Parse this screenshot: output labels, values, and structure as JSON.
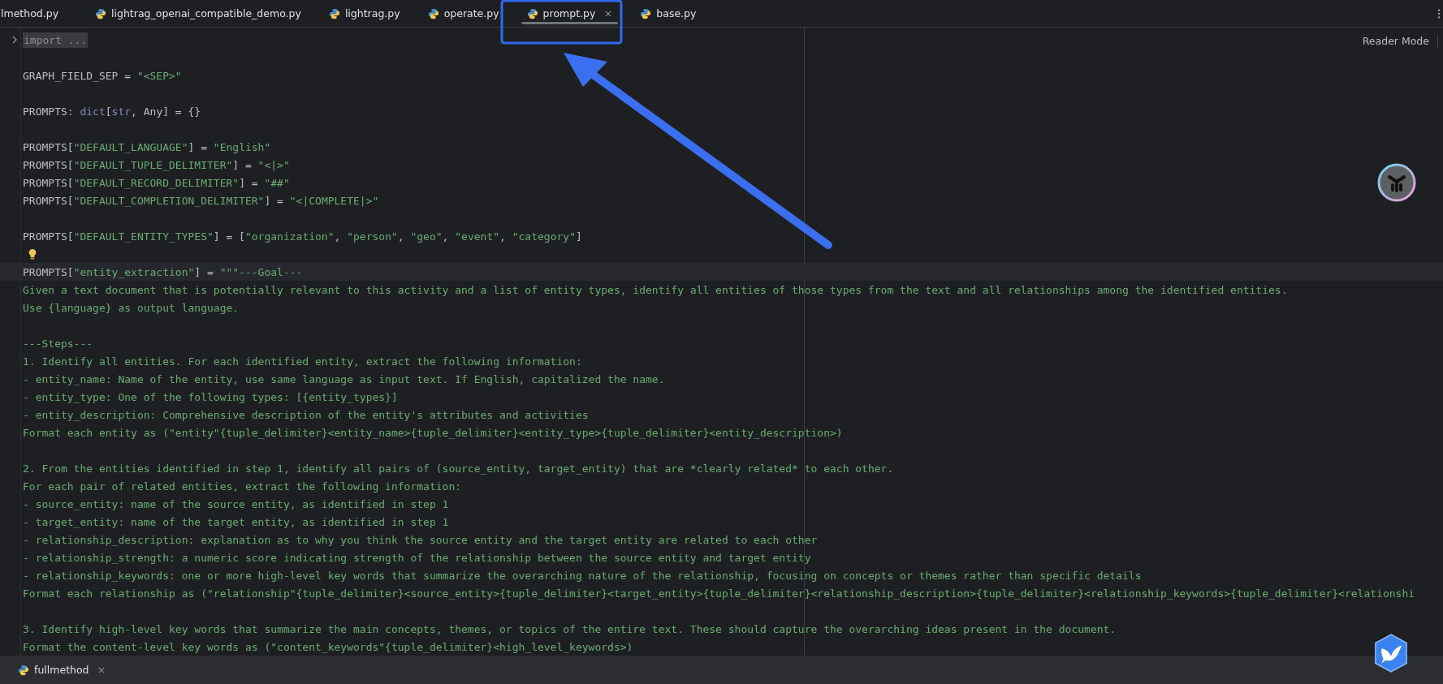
{
  "tabs": [
    {
      "label": "lmethod.py",
      "selected": false,
      "has_icon": false
    },
    {
      "label": "lightrag_openai_compatible_demo.py",
      "selected": false,
      "has_icon": true
    },
    {
      "label": "lightrag.py",
      "selected": false,
      "has_icon": true
    },
    {
      "label": "operate.py",
      "selected": false,
      "has_icon": true
    },
    {
      "label": "prompt.py",
      "selected": true,
      "has_icon": true,
      "close": "×"
    },
    {
      "label": "base.py",
      "selected": false,
      "has_icon": true
    }
  ],
  "reader_mode": "Reader Mode",
  "lines": [
    {
      "kind": "code",
      "current": false,
      "folded": true,
      "tokens": [
        {
          "t": "import ...",
          "kind": "fold"
        }
      ]
    },
    {
      "kind": "blank",
      "current": false
    },
    {
      "kind": "code",
      "current": false,
      "tokens": [
        {
          "t": "GRAPH_FIELD_SEP = ",
          "kind": "plain"
        },
        {
          "t": "\"<SEP>\"",
          "kind": "string"
        }
      ]
    },
    {
      "kind": "blank",
      "current": false
    },
    {
      "kind": "code",
      "current": false,
      "tokens": [
        {
          "t": "PROMPTS: ",
          "kind": "plain"
        },
        {
          "t": "dict",
          "kind": "builtin"
        },
        {
          "t": "[",
          "kind": "plain"
        },
        {
          "t": "str",
          "kind": "builtin"
        },
        {
          "t": ", Any] = {}",
          "kind": "plain"
        }
      ]
    },
    {
      "kind": "blank",
      "current": false
    },
    {
      "kind": "code",
      "current": false,
      "tokens": [
        {
          "t": "PROMPTS[",
          "kind": "plain"
        },
        {
          "t": "\"DEFAULT_LANGUAGE\"",
          "kind": "string"
        },
        {
          "t": "] = ",
          "kind": "plain"
        },
        {
          "t": "\"English\"",
          "kind": "string"
        }
      ]
    },
    {
      "kind": "code",
      "current": false,
      "tokens": [
        {
          "t": "PROMPTS[",
          "kind": "plain"
        },
        {
          "t": "\"DEFAULT_TUPLE_DELIMITER\"",
          "kind": "string"
        },
        {
          "t": "] = ",
          "kind": "plain"
        },
        {
          "t": "\"<|>\"",
          "kind": "string"
        }
      ]
    },
    {
      "kind": "code",
      "current": false,
      "tokens": [
        {
          "t": "PROMPTS[",
          "kind": "plain"
        },
        {
          "t": "\"DEFAULT_RECORD_DELIMITER\"",
          "kind": "string"
        },
        {
          "t": "] = ",
          "kind": "plain"
        },
        {
          "t": "\"##\"",
          "kind": "string"
        }
      ]
    },
    {
      "kind": "code",
      "current": false,
      "tokens": [
        {
          "t": "PROMPTS[",
          "kind": "plain"
        },
        {
          "t": "\"DEFAULT_COMPLETION_DELIMITER\"",
          "kind": "string"
        },
        {
          "t": "] = ",
          "kind": "plain"
        },
        {
          "t": "\"<|COMPLETE|>\"",
          "kind": "string"
        }
      ]
    },
    {
      "kind": "blank",
      "current": false
    },
    {
      "kind": "code",
      "current": false,
      "tokens": [
        {
          "t": "PROMPTS[",
          "kind": "plain"
        },
        {
          "t": "\"DEFAULT_ENTITY_TYPES\"",
          "kind": "string"
        },
        {
          "t": "] = [",
          "kind": "plain"
        },
        {
          "t": "\"organization\"",
          "kind": "string"
        },
        {
          "t": ", ",
          "kind": "plain"
        },
        {
          "t": "\"person\"",
          "kind": "string"
        },
        {
          "t": ", ",
          "kind": "plain"
        },
        {
          "t": "\"geo\"",
          "kind": "string"
        },
        {
          "t": ", ",
          "kind": "plain"
        },
        {
          "t": "\"event\"",
          "kind": "string"
        },
        {
          "t": ", ",
          "kind": "plain"
        },
        {
          "t": "\"category\"",
          "kind": "string"
        },
        {
          "t": "]",
          "kind": "plain"
        }
      ]
    },
    {
      "kind": "bulb",
      "current": false
    },
    {
      "kind": "code",
      "current": true,
      "tokens": [
        {
          "t": "PROMPTS[",
          "kind": "plain"
        },
        {
          "t": "\"entity_extraction\"",
          "kind": "string"
        },
        {
          "t": "] = ",
          "kind": "plain"
        },
        {
          "t": "\"\"\"---Goal---",
          "kind": "string"
        }
      ]
    },
    {
      "kind": "code",
      "current": false,
      "tokens": [
        {
          "t": "Given a text document that is potentially relevant to this activity and a list of entity types, identify all entities of those types from the text and all relationships among the identified entities.",
          "kind": "string"
        }
      ]
    },
    {
      "kind": "code",
      "current": false,
      "tokens": [
        {
          "t": "Use {language} as output language.",
          "kind": "string"
        }
      ]
    },
    {
      "kind": "blank",
      "current": false
    },
    {
      "kind": "code",
      "current": false,
      "tokens": [
        {
          "t": "---Steps---",
          "kind": "string"
        }
      ]
    },
    {
      "kind": "code",
      "current": false,
      "tokens": [
        {
          "t": "1. Identify all entities. For each identified entity, extract the following information:",
          "kind": "string"
        }
      ]
    },
    {
      "kind": "code",
      "current": false,
      "tokens": [
        {
          "t": "- entity_name: Name of the entity, use same language as input text. If English, capitalized the name.",
          "kind": "string"
        }
      ]
    },
    {
      "kind": "code",
      "current": false,
      "tokens": [
        {
          "t": "- entity_type: One of the following types: [{entity_types}]",
          "kind": "string"
        }
      ]
    },
    {
      "kind": "code",
      "current": false,
      "tokens": [
        {
          "t": "- entity_description: Comprehensive description of the entity's attributes and activities",
          "kind": "string"
        }
      ]
    },
    {
      "kind": "code",
      "current": false,
      "tokens": [
        {
          "t": "Format each entity as (\"entity\"{tuple_delimiter}<entity_name>{tuple_delimiter}<entity_type>{tuple_delimiter}<entity_description>)",
          "kind": "string"
        }
      ]
    },
    {
      "kind": "blank",
      "current": false
    },
    {
      "kind": "code",
      "current": false,
      "tokens": [
        {
          "t": "2. From the entities identified in step 1, identify all pairs of (source_entity, target_entity) that are *clearly related* to each other.",
          "kind": "string"
        }
      ]
    },
    {
      "kind": "code",
      "current": false,
      "tokens": [
        {
          "t": "For each pair of related entities, extract the following information:",
          "kind": "string"
        }
      ]
    },
    {
      "kind": "code",
      "current": false,
      "tokens": [
        {
          "t": "- source_entity: name of the source entity, as identified in step 1",
          "kind": "string"
        }
      ]
    },
    {
      "kind": "code",
      "current": false,
      "tokens": [
        {
          "t": "- target_entity: name of the target entity, as identified in step 1",
          "kind": "string"
        }
      ]
    },
    {
      "kind": "code",
      "current": false,
      "tokens": [
        {
          "t": "- relationship_description: explanation as to why you think the source entity and the target entity are related to each other",
          "kind": "string"
        }
      ]
    },
    {
      "kind": "code",
      "current": false,
      "tokens": [
        {
          "t": "- relationship_strength: a numeric score indicating strength of the relationship between the source entity and target entity",
          "kind": "string"
        }
      ]
    },
    {
      "kind": "code",
      "current": false,
      "tokens": [
        {
          "t": "- relationship_keywords: one or more high-level key words that summarize the overarching nature of the relationship, focusing on concepts or themes rather than specific details",
          "kind": "string"
        }
      ]
    },
    {
      "kind": "code",
      "current": false,
      "tokens": [
        {
          "t": "Format each relationship as (\"relationship\"{tuple_delimiter}<source_entity>{tuple_delimiter}<target_entity>{tuple_delimiter}<relationship_description>{tuple_delimiter}<relationship_keywords>{tuple_delimiter}<relationshi",
          "kind": "string"
        }
      ]
    },
    {
      "kind": "blank",
      "current": false
    },
    {
      "kind": "code",
      "current": false,
      "tokens": [
        {
          "t": "3. Identify high-level key words that summarize the main concepts, themes, or topics of the entire text. These should capture the overarching ideas present in the document.",
          "kind": "string"
        }
      ]
    },
    {
      "kind": "code",
      "current": false,
      "tokens": [
        {
          "t": "Format the content-level key words as (\"content_keywords\"{tuple_delimiter}<high_level_keywords>)",
          "kind": "string"
        }
      ]
    }
  ],
  "bottom_tabs": [
    {
      "label": "fullmethod",
      "selected": false,
      "close": "×"
    }
  ]
}
